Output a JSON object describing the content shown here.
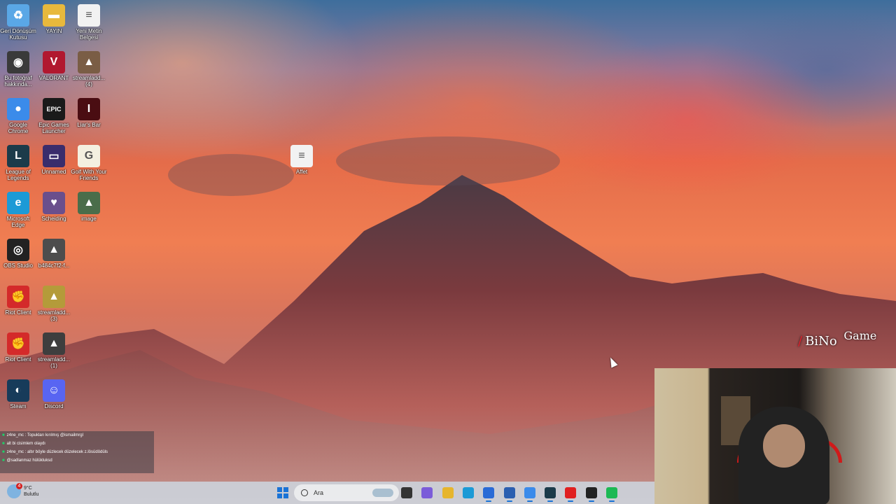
{
  "desktop": {
    "icons": [
      {
        "label": "Geri Dönüşüm Kutusu",
        "icon": "recycle-bin-icon",
        "color": "#5aa7e6",
        "glyph": "♻"
      },
      {
        "label": "YAYIN",
        "icon": "folder-icon",
        "color": "#e8b93c",
        "glyph": "▬"
      },
      {
        "label": "Yeni Metin Belgesi",
        "icon": "text-file-icon",
        "color": "#f2f2f2",
        "glyph": "≡"
      },
      {
        "label": "Bu fotoğraf hakkında...",
        "icon": "camera-icon",
        "color": "#3a3a3a",
        "glyph": "◉"
      },
      {
        "label": "VALORANT",
        "icon": "valorant-icon",
        "color": "#b1182f",
        "glyph": "V"
      },
      {
        "label": "streamladd... (4)",
        "icon": "image-thumb-icon",
        "color": "#7a5d45",
        "glyph": "▲"
      },
      {
        "label": "Google Chrome",
        "icon": "chrome-icon",
        "color": "#3b8bea",
        "glyph": "●"
      },
      {
        "label": "Epic Games Launcher",
        "icon": "epic-games-icon",
        "color": "#1a1a1a",
        "glyph": "EPIC"
      },
      {
        "label": "Liar's Bar",
        "icon": "liars-bar-icon",
        "color": "#4a0d12",
        "glyph": "I"
      },
      {
        "label": "League of Legends",
        "icon": "league-of-legends-icon",
        "color": "#1c3b4a",
        "glyph": "L"
      },
      {
        "label": "Unnamed",
        "icon": "unnamed-app-icon",
        "color": "#3a2d6c",
        "glyph": "▭"
      },
      {
        "label": "Golf With Your Friends",
        "icon": "golf-with-friends-icon",
        "color": "#f4f0e0",
        "glyph": "G"
      },
      {
        "label": "Microsoft Edge",
        "icon": "edge-icon",
        "color": "#1c9ad6",
        "glyph": "e"
      },
      {
        "label": "Scheiding",
        "icon": "scheiding-icon",
        "color": "#6a4f8c",
        "glyph": "♥"
      },
      {
        "label": "image",
        "icon": "image-file-icon",
        "color": "#4a6d4a",
        "glyph": "▲"
      },
      {
        "label": "OBS Studio",
        "icon": "obs-icon",
        "color": "#222222",
        "glyph": "◎"
      },
      {
        "label": "b484c7f2-f...",
        "icon": "image-thumb-icon",
        "color": "#4d4d4d",
        "glyph": "▲"
      },
      {
        "label": "Riot Client",
        "icon": "riot-client-icon",
        "color": "#d42a2a",
        "glyph": "✊"
      },
      {
        "label": "streamladd... (3)",
        "icon": "image-thumb-icon",
        "color": "#b49b3a",
        "glyph": "▲"
      },
      {
        "label": "Riot Client",
        "icon": "riot-client-icon",
        "color": "#d42a2a",
        "glyph": "✊"
      },
      {
        "label": "streamladd... (1)",
        "icon": "image-thumb-icon",
        "color": "#3e3e3e",
        "glyph": "▲"
      },
      {
        "label": "Steam",
        "icon": "steam-icon",
        "color": "#173b5a",
        "glyph": "◐"
      },
      {
        "label": "Discord",
        "icon": "discord-icon",
        "color": "#5865f2",
        "glyph": "☺"
      },
      {
        "label": "Affet",
        "icon": "text-file-icon",
        "color": "#f2f2f2",
        "glyph": "≡"
      }
    ]
  },
  "chat": {
    "messages": [
      {
        "text": "z4ne_mc : Topukları kırılmış @ismailmrgl"
      },
      {
        "text": "alt bi cisimlem olaydı"
      },
      {
        "text": "z4ne_mc : altır böyle düzlecek düzelecek z.lösüdödüls"
      },
      {
        "text": "@sadlanmaz hülükluksd"
      }
    ]
  },
  "watermark": {
    "text": "BiNo",
    "text2": "Game"
  },
  "taskbar": {
    "weather_temp": "9°C",
    "weather_cond": "Bulutlu",
    "weather_badge": "4",
    "search_placeholder": "Ara",
    "apps": [
      {
        "name": "task-view",
        "color": "#333333"
      },
      {
        "name": "copilot",
        "color": "#7b5cd9"
      },
      {
        "name": "file-explorer",
        "color": "#e6b52d"
      },
      {
        "name": "edge",
        "color": "#1c9ad6"
      },
      {
        "name": "microsoft-store",
        "color": "#2a6bd6"
      },
      {
        "name": "outlook",
        "color": "#2b5fb0"
      },
      {
        "name": "chrome",
        "color": "#3b8bea"
      },
      {
        "name": "league-client",
        "color": "#1c3b4a"
      },
      {
        "name": "youtube",
        "color": "#e02020"
      },
      {
        "name": "obs",
        "color": "#222222"
      },
      {
        "name": "spotify",
        "color": "#1db954"
      }
    ]
  }
}
